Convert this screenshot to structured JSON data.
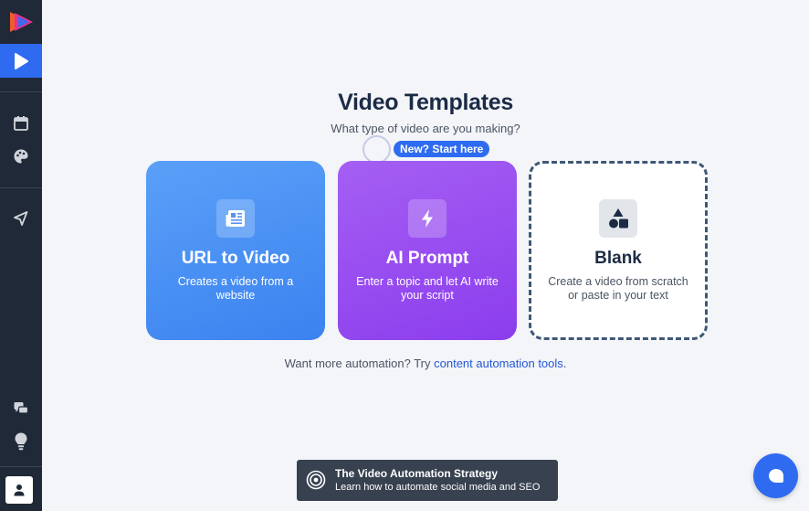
{
  "header": {
    "title": "Video Templates",
    "subtitle": "What type of video are you making?",
    "badge": "New? Start here"
  },
  "cards": [
    {
      "title": "URL to Video",
      "description": "Creates a video from a website",
      "icon": "newspaper-icon"
    },
    {
      "title": "AI Prompt",
      "description": "Enter a topic and let AI write your script",
      "icon": "lightning-icon"
    },
    {
      "title": "Blank",
      "description": "Create a video from scratch or paste in your text",
      "icon": "shapes-icon"
    }
  ],
  "footer_text": {
    "prefix": "Want more automation? Try ",
    "link": "content automation tools",
    "suffix": "."
  },
  "banner": {
    "title": "The Video Automation Strategy",
    "subtitle": "Learn how to automate social media and SEO"
  },
  "sidebar": {
    "items": [
      "play-icon",
      "calendar-icon",
      "palette-icon",
      "send-icon",
      "chat-icon",
      "lightbulb-icon",
      "user-icon"
    ]
  },
  "colors": {
    "accent": "#2f6bf0",
    "sidebar": "#1f2937",
    "url_card": "#4a90f4",
    "ai_card": "#9a4ef0"
  }
}
